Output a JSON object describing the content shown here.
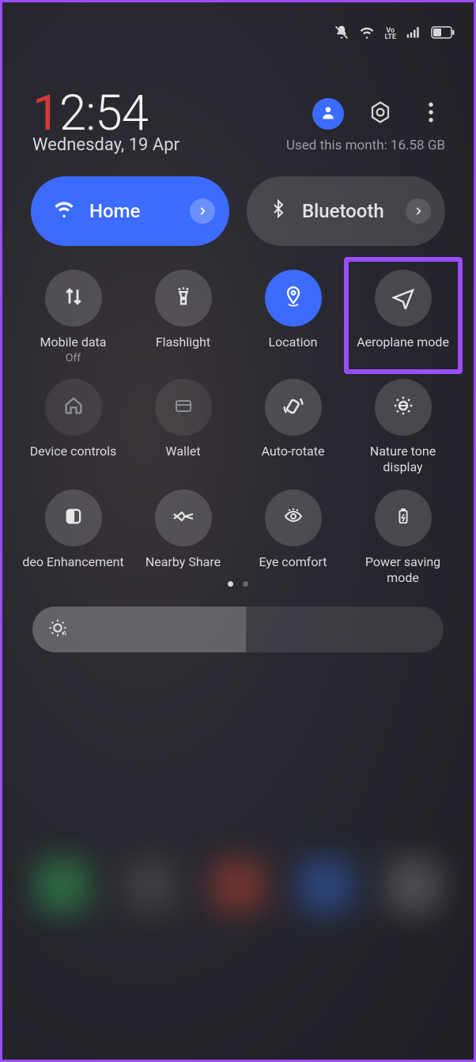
{
  "clock": {
    "hour": "1",
    "minute": "2:54"
  },
  "date": "Wednesday, 19 Apr",
  "usage": "Used this month: 16.58 GB",
  "pills": {
    "wifi": {
      "label": "Home"
    },
    "bt": {
      "label": "Bluetooth"
    }
  },
  "tiles": [
    {
      "label": "Mobile data",
      "sub": "Off"
    },
    {
      "label": "Flashlight"
    },
    {
      "label": "Location"
    },
    {
      "label": "Aeroplane mode"
    },
    {
      "label": "Device controls"
    },
    {
      "label": "Wallet"
    },
    {
      "label": "Auto-rotate"
    },
    {
      "label": "Nature tone display"
    },
    {
      "label": "deo Enhancement"
    },
    {
      "label": "Nearby Share"
    },
    {
      "label": "Eye comfort"
    },
    {
      "label": "Power saving mode"
    }
  ],
  "highlight_tile_index": 3,
  "colors": {
    "accent": "#3b6bff",
    "highlight": "#9b4dff"
  }
}
